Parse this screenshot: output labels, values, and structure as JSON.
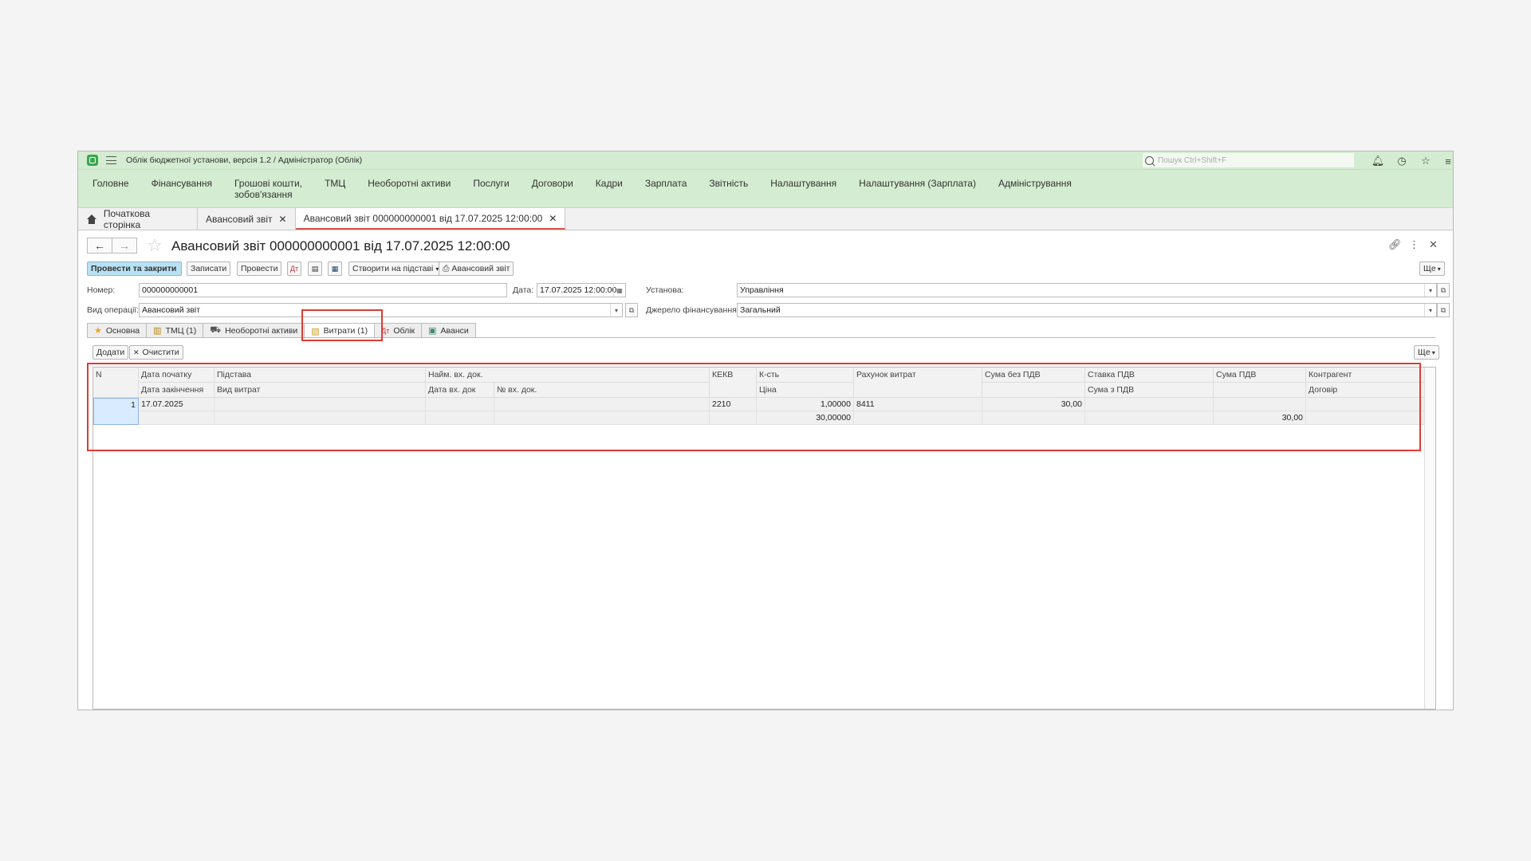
{
  "app": {
    "title": "Облік бюджетної установи, версія 1.2 / Адміністратор  (Облік)",
    "search_placeholder": "Пошук Ctrl+Shift+F"
  },
  "menu": [
    "Головне",
    "Фінансування",
    "Грошові кошти,\nзобов'язання",
    "ТМЦ",
    "Необоротні активи",
    "Послуги",
    "Договори",
    "Кадри",
    "Зарплата",
    "Звітність",
    "Налаштування",
    "Налаштування (Зарплата)",
    "Адміністрування"
  ],
  "open_tabs": [
    "Початкова сторінка",
    "Авансовий звіт",
    "Авансовий звіт 000000000001 від 17.07.2025 12:00:00"
  ],
  "document": {
    "title": "Авансовий звіт 000000000001 від 17.07.2025 12:00:00"
  },
  "commands": {
    "post_close": "Провести та закрити",
    "save": "Записати",
    "post": "Провести",
    "create_based": "Створити на підставі",
    "report": "Авансовий звіт",
    "more": "Ще"
  },
  "fields": {
    "number_label": "Номер:",
    "number_value": "000000000001",
    "date_label": "Дата:",
    "date_value": "17.07.2025 12:00:00",
    "org_label": "Установа:",
    "org_value": "Управління",
    "op_label": "Вид операції:",
    "op_value": "Авансовий звіт",
    "source_label": "Джерело фінансування:",
    "source_value": "Загальний"
  },
  "form_tabs": [
    "Основна",
    "ТМЦ (1)",
    "Необоротні активи",
    "Витрати (1)",
    "Облік",
    "Аванси"
  ],
  "table_commands": {
    "add": "Додати",
    "clear": "Очистити",
    "more": "Ще"
  },
  "table": {
    "headers_row1": [
      "N",
      "Дата початку",
      "Підстава",
      "Найм. вх. док.",
      "КЕКВ",
      "К-сть",
      "Рахунок витрат",
      "Сума без ПДВ",
      "Ставка ПДВ",
      "Сума ПДВ",
      "Контрагент"
    ],
    "headers_row2": [
      "Дата закінчення",
      "Вид витрат",
      "Дата вх. док",
      "№ вх. док.",
      "Ціна",
      "Сума з ПДВ",
      "Договір"
    ],
    "row": {
      "n": "1",
      "date_start": "17.07.2025",
      "kekv": "2210",
      "qty": "1,00000",
      "account": "8411",
      "sum_no_vat": "30,00",
      "price": "30,00000",
      "sum_with_vat": "30,00"
    }
  },
  "colors": {
    "title_bg": "#d4ecd1",
    "highlight": "#e03c31",
    "primary_btn": "#b8e2f3"
  }
}
